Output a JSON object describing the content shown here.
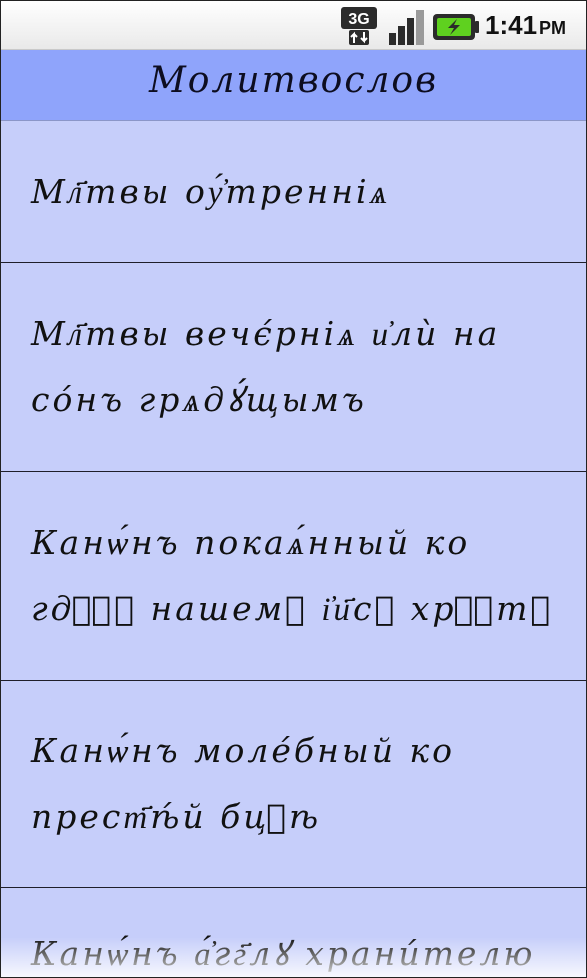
{
  "status_bar": {
    "network_type": "3G",
    "signal_icon": "signal-bars-icon",
    "battery_icon": "battery-charging-icon",
    "time": "1:41",
    "ampm": "PM"
  },
  "app": {
    "title": "Молитвослов"
  },
  "list": {
    "items": [
      {
        "label": "Мл҃твы оу҆́тренніѧ"
      },
      {
        "label": "Мл҃твы вечє́рніѧ и҆лѝ на со́нъ грѧдꙋ́щымъ"
      },
      {
        "label": "Канѡ́нъ покаѧ́нный ко гдⷭ҇ꙋ нашемꙋ і҆и҃сꙋ хрⷭ҇тꙋ"
      },
      {
        "label": "Канѡ́нъ моле́бный ко прест҃ѣ́й бцⷣѣ"
      },
      {
        "label": "Канѡ́нъ а҆́гг҃лꙋ храни́телю"
      }
    ]
  },
  "colors": {
    "title_bar": "#8fa4fb",
    "list_bg": "#c6cefa",
    "divider": "#1f1f2a"
  }
}
